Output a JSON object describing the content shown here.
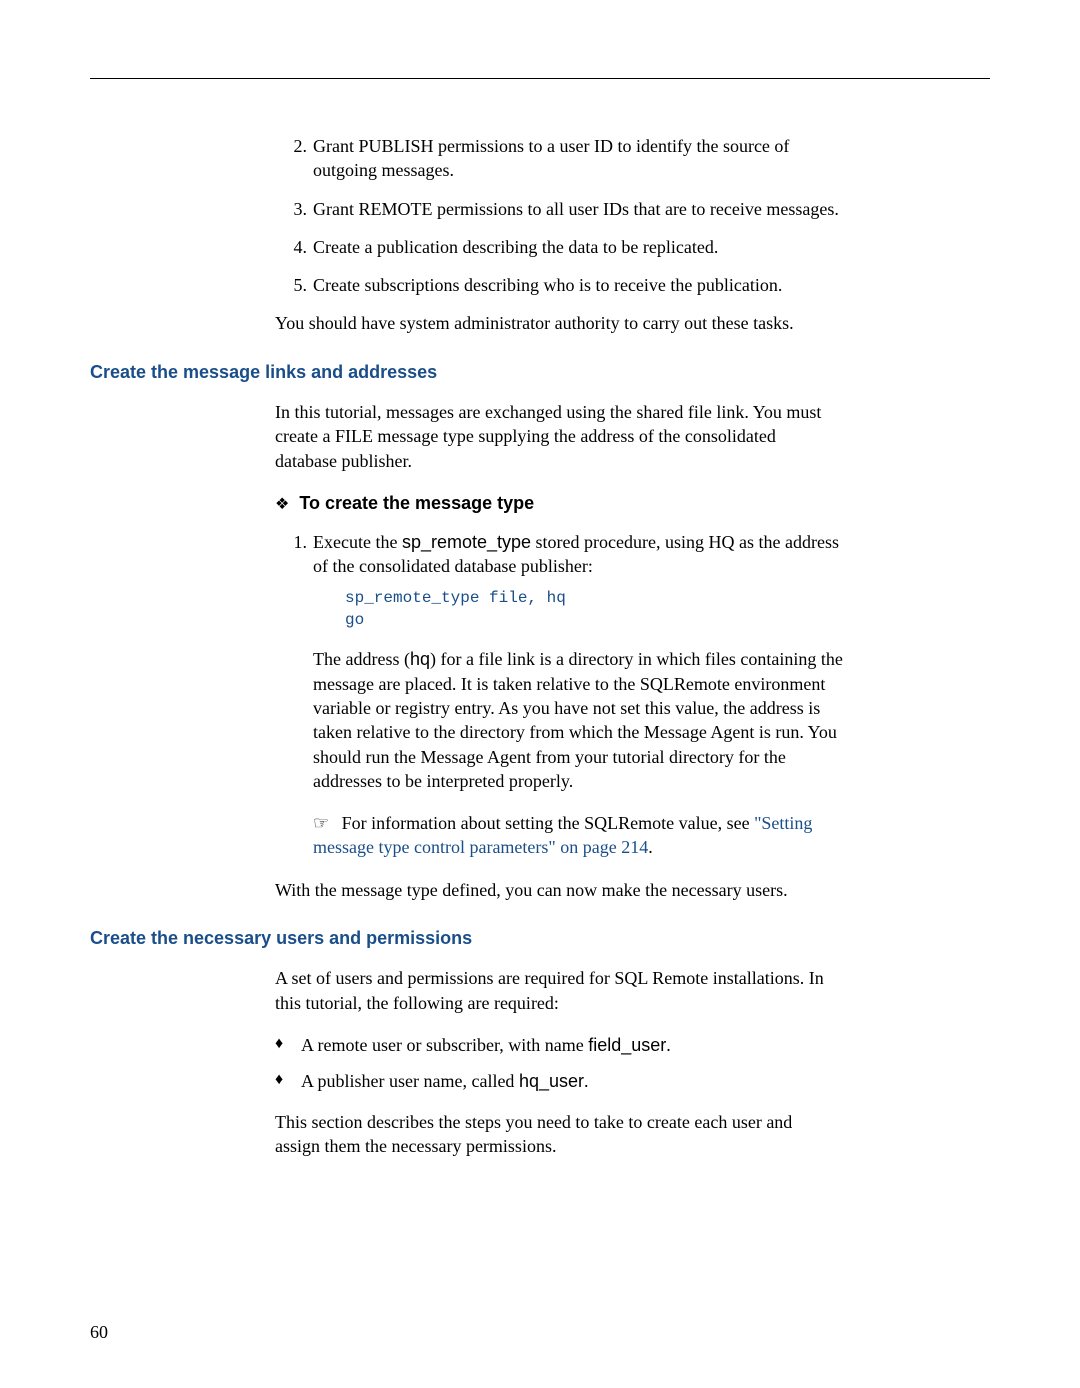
{
  "list2_num": "2.",
  "list2_text_a": "Grant PUBLISH permissions to a user ID to identify the source of",
  "list2_text_b": "outgoing messages.",
  "list3_num": "3.",
  "list3_text": "Grant REMOTE permissions to all user IDs that are to receive messages.",
  "list4_num": "4.",
  "list4_text": "Create a publication describing the data to be replicated.",
  "list5_num": "5.",
  "list5_text": "Create subscriptions describing who is to receive the publication.",
  "after_list_para": "You should have system administrator authority to carry out these tasks.",
  "heading1": "Create the message links and addresses",
  "para1_a": "In this tutorial, messages are exchanged using the shared file link. You must",
  "para1_b": "create a FILE message type supplying the address of the consolidated",
  "para1_c": "database publisher.",
  "diamond": "❖",
  "to_create_label": "To create the message type",
  "step1_num": "1.",
  "step1_text_a": "Execute the ",
  "step1_inline": "sp_remote_type",
  "step1_text_b": " stored procedure, using HQ as the address",
  "step1_text_c": "of the consolidated database publisher:",
  "code": "sp_remote_type file, hq\ngo",
  "para2_a": "The address (",
  "para2_hq": "hq",
  "para2_b": ") for a file link is a directory in which files containing the",
  "para2_c": "message are placed. It is taken relative to the SQLRemote environment",
  "para2_d": "variable or registry entry. As you have not set this value, the address is",
  "para2_e": "taken relative to the directory from which the Message Agent is run. You",
  "para2_f": "should run the Message Agent from your tutorial directory for the",
  "para2_g": "addresses to be interpreted properly.",
  "pointer": "☞",
  "info_a": " For information about setting the SQLRemote value, see ",
  "info_link1": "\"Setting",
  "info_link2": "message type control parameters\" on page 214",
  "info_period": ".",
  "para3": "With the message type defined, you can now make the necessary users.",
  "heading2": "Create the necessary users and permissions",
  "para4_a": "A set of users and permissions are required for SQL Remote installations. In",
  "para4_b": "this tutorial, the following are required:",
  "bullet_mark": "♦",
  "bullet1_a": "A remote user or subscriber, with name ",
  "bullet1_inline": "ﬁeld_user",
  "bullet1_b": ".",
  "bullet2_a": "A publisher user name, called ",
  "bullet2_inline": "hq_user",
  "bullet2_b": ".",
  "para5_a": "This section describes the steps you need to take to create each user and",
  "para5_b": "assign them the necessary permissions.",
  "page_number": "60"
}
